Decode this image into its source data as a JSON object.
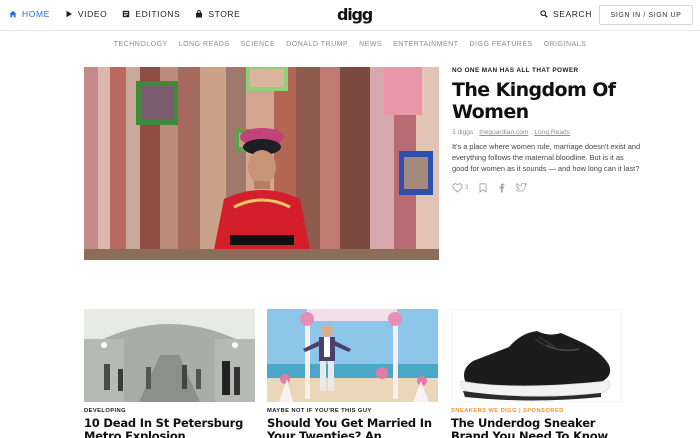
{
  "header": {
    "nav": [
      {
        "label": "HOME",
        "icon": "home-icon",
        "active": true
      },
      {
        "label": "VIDEO",
        "icon": "play-icon",
        "active": false
      },
      {
        "label": "EDITIONS",
        "icon": "editions-icon",
        "active": false
      },
      {
        "label": "STORE",
        "icon": "store-bag-icon",
        "active": false
      }
    ],
    "logo": "digg",
    "search_label": "SEARCH",
    "signin_label": "SIGN IN / SIGN UP"
  },
  "categories": [
    "TECHNOLOGY",
    "LONG READS",
    "SCIENCE",
    "DONALD TRUMP",
    "NEWS",
    "ENTERTAINMENT",
    "DIGG FEATURES",
    "ORIGINALS"
  ],
  "hero": {
    "kicker": "NO ONE MAN HAS ALL THAT POWER",
    "title": "The Kingdom Of Women",
    "diggs": "3 diggs",
    "source": "theguardian.com",
    "tag": "Long Reads",
    "description": "It's a place where women rule, marriage doesn't exist and everything follows the maternal bloodline. But is it as good for women as it sounds — and how long can it last?",
    "digg_count": "3"
  },
  "cards": [
    {
      "kicker": "DEVELOPING",
      "title": "10 Dead In St Petersburg Metro Explosion",
      "sponsored": false
    },
    {
      "kicker": "MAYBE NOT IF YOU'RE THIS GUY",
      "title": "Should You Get Married In Your Twenties? An",
      "sponsored": false
    },
    {
      "kicker": "SNEAKERS WE DIGG | SPONSORED",
      "title": "The Underdog Sneaker Brand You Need To Know About",
      "sponsored": true
    }
  ],
  "colors": {
    "accent": "#2a70d6",
    "sponsored": "#e8962f"
  }
}
